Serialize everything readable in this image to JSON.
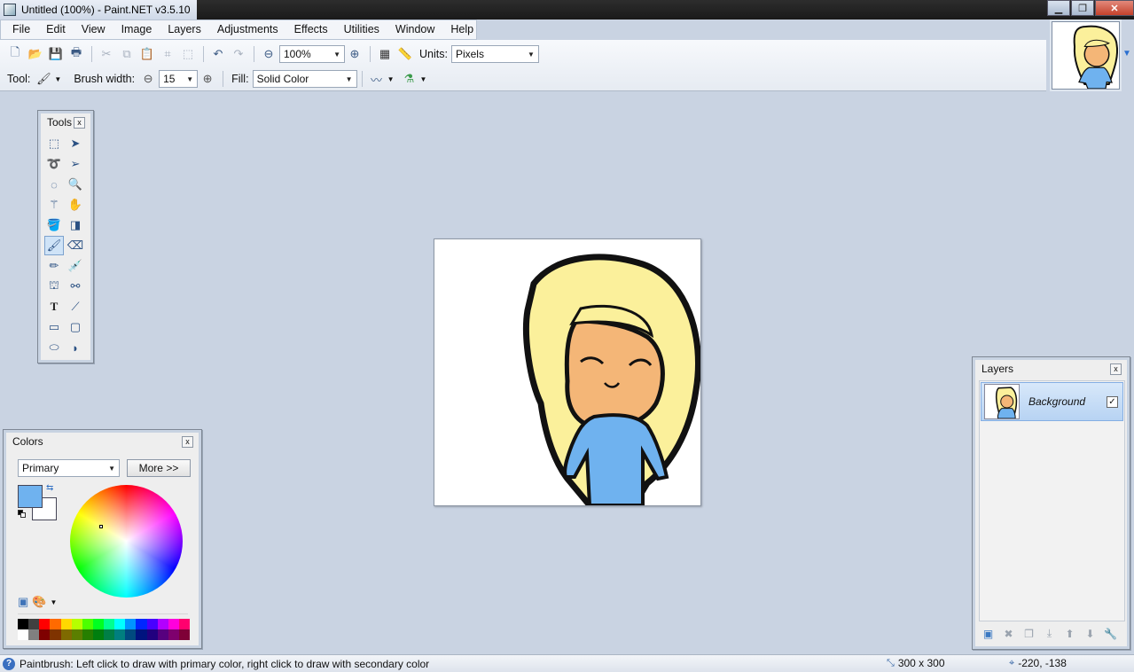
{
  "window": {
    "title": "Untitled (100%) - Paint.NET v3.5.10",
    "minimize": "▁",
    "maximize": "❐",
    "close": "✕"
  },
  "menu": [
    "File",
    "Edit",
    "View",
    "Image",
    "Layers",
    "Adjustments",
    "Effects",
    "Utilities",
    "Window",
    "Help"
  ],
  "toolbar": {
    "zoom_value": "100%",
    "units_label": "Units:",
    "units_value": "Pixels",
    "tool_label": "Tool:",
    "brush_width_label": "Brush width:",
    "brush_width_value": "15",
    "fill_label": "Fill:",
    "fill_value": "Solid Color"
  },
  "tools_panel": {
    "title": "Tools",
    "close": "x",
    "active_tool": "paintbrush-tool",
    "tools": [
      "rectangle-select-tool",
      "move-selection-tool",
      "lasso-select-tool",
      "move-selected-tool",
      "ellipse-select-tool",
      "zoom-tool",
      "magic-wand-tool",
      "pan-tool",
      "paint-bucket-tool",
      "gradient-tool",
      "paintbrush-tool",
      "eraser-tool",
      "pencil-tool",
      "color-picker-tool",
      "clone-stamp-tool",
      "recolor-tool",
      "text-tool",
      "line-curve-tool",
      "rectangle-tool",
      "rounded-rectangle-tool",
      "ellipse-tool",
      "freeform-shape-tool"
    ]
  },
  "colors_panel": {
    "title": "Colors",
    "close": "x",
    "mode_value": "Primary",
    "more_button": "More >>",
    "primary_color": "#6fb2ef",
    "secondary_color": "#ffffff",
    "palette": [
      "#000000",
      "#404040",
      "#ff0000",
      "#ff6a00",
      "#ffd800",
      "#b6ff00",
      "#4cff00",
      "#00ff21",
      "#00ff90",
      "#00ffff",
      "#0094ff",
      "#0026ff",
      "#4800ff",
      "#b200ff",
      "#ff00dc",
      "#ff006e",
      "#ffffff",
      "#808080",
      "#7f0000",
      "#7f3300",
      "#7f6a00",
      "#5b7f00",
      "#267f00",
      "#007f0e",
      "#007f46",
      "#007f7f",
      "#004a7f",
      "#00137f",
      "#21007f",
      "#57007f",
      "#7f006e",
      "#7f0037"
    ]
  },
  "layers_panel": {
    "title": "Layers",
    "close": "x",
    "layers": [
      {
        "name": "Background",
        "visible": "✓"
      }
    ]
  },
  "status": {
    "help_icon": "?",
    "message": "Paintbrush: Left click to draw with primary color, right click to draw with secondary color",
    "image_size": "300 x 300",
    "cursor_position": "-220, -138"
  }
}
